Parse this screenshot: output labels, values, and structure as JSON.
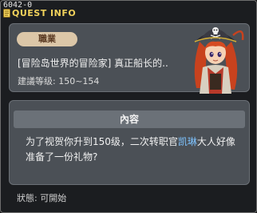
{
  "window": {
    "quest_id": "6042-0",
    "title": "QUEST INFO"
  },
  "quest": {
    "job_badge": "職業",
    "name": "[冒险岛世界的冒险家] 真正船长的..",
    "level_requirement": "建議等级: 150~154",
    "npc_icon": "pirate-captain-portrait"
  },
  "content": {
    "header": "內容",
    "text_before_npc": "为了视贺你升到150级，二次转职官",
    "npc_name": "凯琳",
    "text_after_npc": "大人好像准备了一份礼物?"
  },
  "status": {
    "label": "狀態: 可開始"
  },
  "colors": {
    "title": "#f0d15b",
    "npc_name": "#7ec3ff",
    "panel": "#4b5056",
    "badge": "#dcc7a8"
  }
}
